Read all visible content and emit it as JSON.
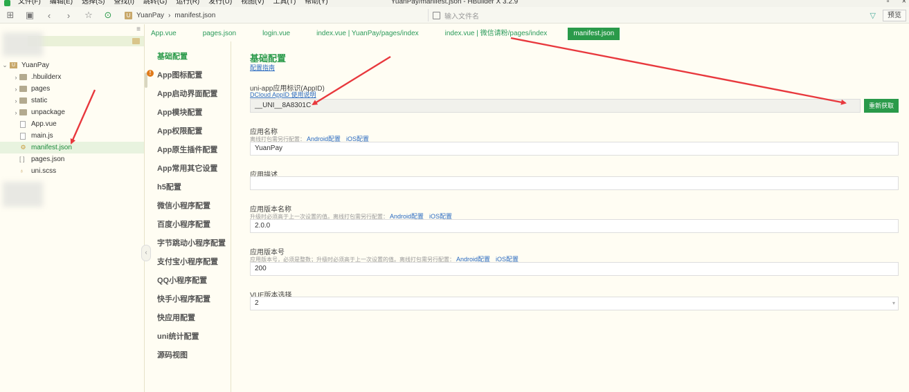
{
  "window": {
    "title": "YuanPay/manifest.json - HBuilder X 3.2.9",
    "menus": [
      "文件(F)",
      "编辑(E)",
      "选择(S)",
      "查找(I)",
      "跳转(G)",
      "运行(R)",
      "发行(U)",
      "视图(V)",
      "工具(T)",
      "帮助(Y)"
    ]
  },
  "toolbar": {
    "breadcrumb": [
      "YuanPay",
      "manifest.json"
    ],
    "file_search_placeholder": "输入文件名",
    "preview_label": "预览"
  },
  "tree": {
    "project": "YuanPay",
    "items": [
      {
        "label": ".hbuilderx",
        "type": "folder"
      },
      {
        "label": "pages",
        "type": "folder"
      },
      {
        "label": "static",
        "type": "folder"
      },
      {
        "label": "unpackage",
        "type": "folder"
      },
      {
        "label": "App.vue",
        "type": "file"
      },
      {
        "label": "main.js",
        "type": "file"
      },
      {
        "label": "manifest.json",
        "type": "gear-file",
        "selected": true
      },
      {
        "label": "pages.json",
        "type": "bracket-file"
      },
      {
        "label": "uni.scss",
        "type": "scss-file"
      }
    ]
  },
  "tabs": [
    {
      "label": "App.vue"
    },
    {
      "label": "pages.json"
    },
    {
      "label": "login.vue"
    },
    {
      "label": "index.vue | YuanPay/pages/index"
    },
    {
      "label": "index.vue | 微信请粉/pages/index"
    },
    {
      "label": "manifest.json",
      "active": true
    }
  ],
  "config_nav": [
    {
      "label": "基础配置",
      "active": true
    },
    {
      "label": "App图标配置",
      "warning": true
    },
    {
      "label": "App启动界面配置"
    },
    {
      "label": "App模块配置"
    },
    {
      "label": "App权限配置"
    },
    {
      "label": "App原生插件配置"
    },
    {
      "label": "App常用其它设置"
    },
    {
      "label": "h5配置"
    },
    {
      "label": "微信小程序配置"
    },
    {
      "label": "百度小程序配置"
    },
    {
      "label": "字节跳动小程序配置"
    },
    {
      "label": "支付宝小程序配置"
    },
    {
      "label": "QQ小程序配置"
    },
    {
      "label": "快手小程序配置"
    },
    {
      "label": "快应用配置"
    },
    {
      "label": "uni统计配置"
    },
    {
      "label": "源码视图"
    }
  ],
  "form": {
    "section_title": "基础配置",
    "guide_link": "配置指南",
    "appid": {
      "label": "uni-app应用标识(AppID)",
      "help_link": "DCloud AppID 使用说明",
      "value": "__UNI__8A8301C",
      "button": "重新获取"
    },
    "app_name": {
      "label": "应用名称",
      "note": "离线打包需另行配置：",
      "android_link": "Android配置",
      "ios_link": "iOS配置",
      "value": "YuanPay"
    },
    "app_desc": {
      "label": "应用描述",
      "value": ""
    },
    "version_name": {
      "label": "应用版本名称",
      "note": "升级时必须高于上一次设置的值。离线打包需另行配置：",
      "android_link": "Android配置",
      "ios_link": "iOS配置",
      "value": "2.0.0"
    },
    "version_code": {
      "label": "应用版本号",
      "note": "应用版本号，必须是整数；升级时必须高于上一次设置的值。离线打包需另行配置：",
      "android_link": "Android配置",
      "ios_link": "iOS配置",
      "value": "200"
    },
    "vue_version": {
      "label": "VUE版本选择",
      "value": "2"
    }
  },
  "colors": {
    "accent": "#2a9a4a",
    "annotation_arrow": "#e8383d",
    "background": "#fffdf3"
  }
}
